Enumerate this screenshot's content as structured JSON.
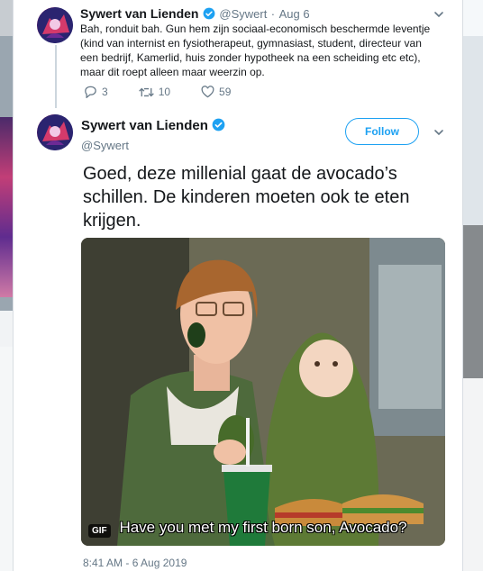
{
  "reply_tweet": {
    "author_name": "Sywert van Lienden",
    "handle": "@Sywert",
    "separator": "·",
    "date": "Aug 6",
    "text": "Bah, ronduit bah. Gun hem zijn sociaal-economisch beschermde leventje (kind van internist en fysiotherapeut, gymnasiast, student, directeur van een bedrijf, Kamerlid, huis zonder hypotheek na een scheiding etc etc), maar dit roept alleen maar weerzin op.",
    "replies": "3",
    "retweets": "10",
    "likes": "59"
  },
  "main_tweet": {
    "author_name": "Sywert van Lienden",
    "handle": "@Sywert",
    "follow_label": "Follow",
    "text": "Goed, deze millenial gaat de avocado’s schillen. De kinderen moeten ook te eten krijgen.",
    "media": {
      "caption": "Have you met my first born son, Avocado?",
      "badge": "GIF"
    },
    "timestamp": "8:41 AM - 6 Aug 2019"
  },
  "colors": {
    "accent": "#1da1f2",
    "secondary_text": "#657786",
    "verified": "#1da1f2"
  },
  "icons": [
    "verified-badge-icon",
    "chevron-down-icon",
    "reply-icon",
    "retweet-icon",
    "like-icon"
  ]
}
